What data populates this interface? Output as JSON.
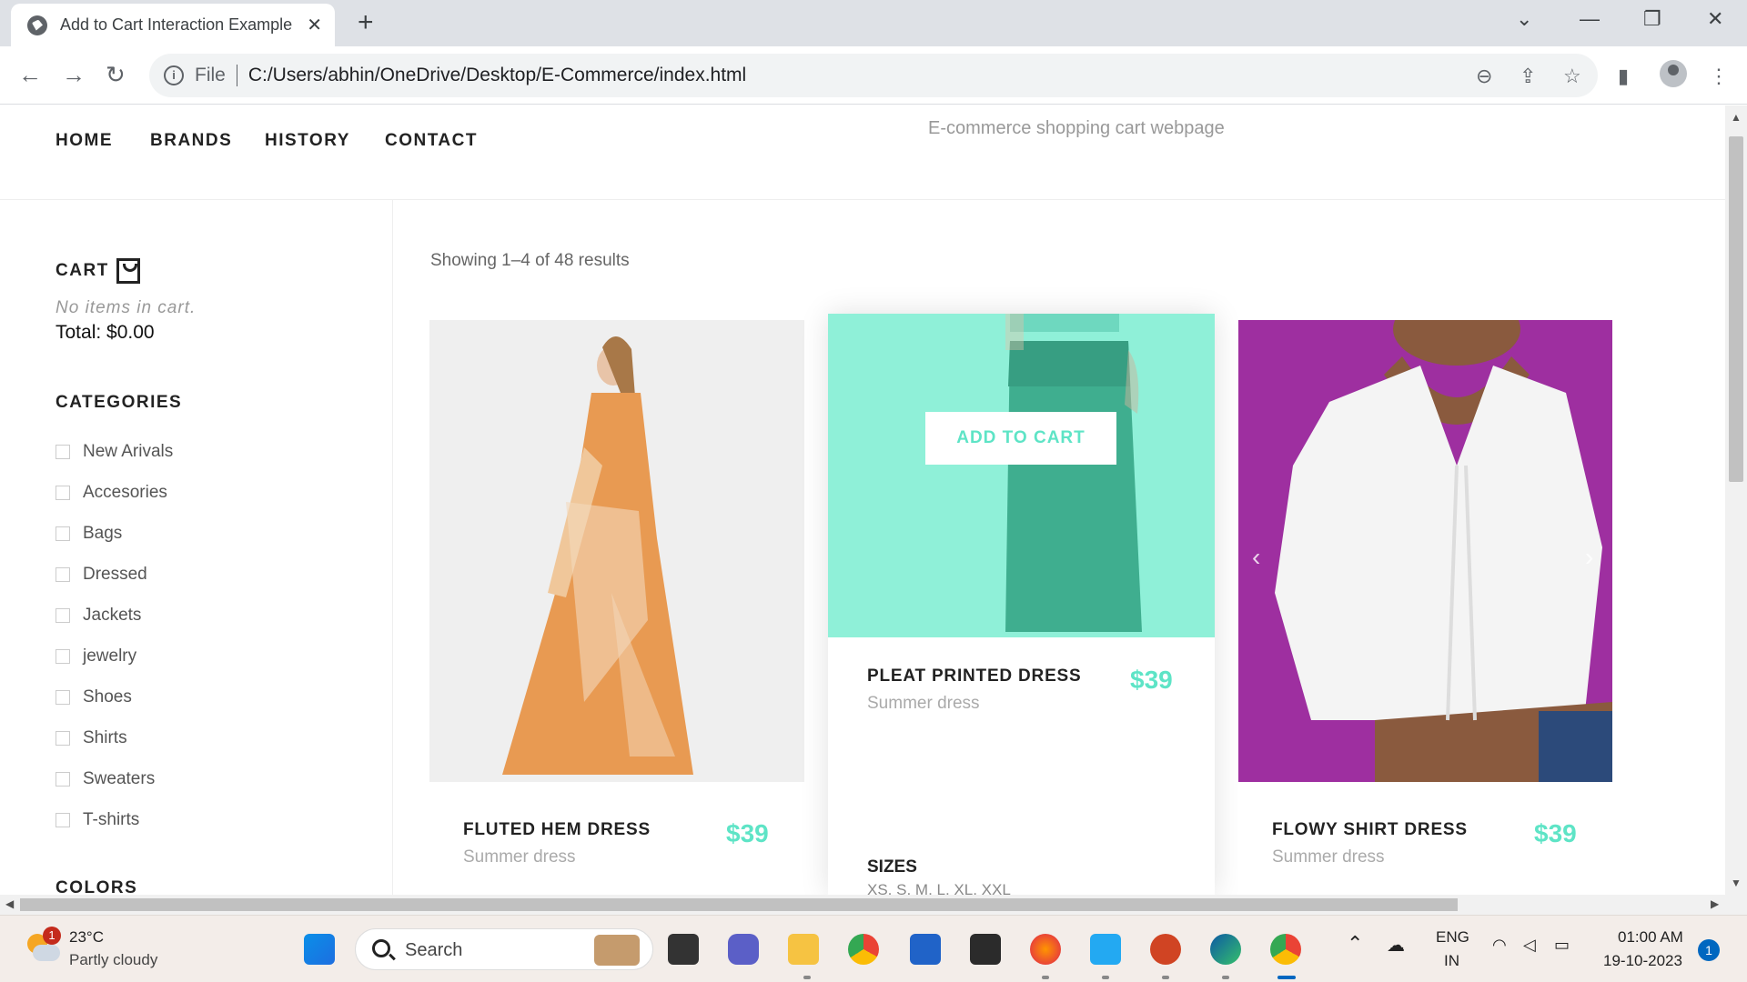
{
  "browser": {
    "tab_title": "Add to Cart Interaction Example",
    "url_scheme": "File",
    "url": "C:/Users/abhin/OneDrive/Desktop/E-Commerce/index.html"
  },
  "nav": {
    "links": [
      "HOME",
      "BRANDS",
      "HISTORY",
      "CONTACT"
    ],
    "tagline": "E-commerce shopping cart webpage"
  },
  "cart": {
    "heading": "CART",
    "empty_text": "No items in cart.",
    "total": "Total: $0.00"
  },
  "categories": {
    "heading": "CATEGORIES",
    "items": [
      "New Arivals",
      "Accesories",
      "Bags",
      "Dressed",
      "Jackets",
      "jewelry",
      "Shoes",
      "Shirts",
      "Sweaters",
      "T-shirts"
    ]
  },
  "colors": {
    "heading": "COLORS"
  },
  "results_text": "Showing 1–4 of 48 results",
  "products": [
    {
      "name": "FLUTED HEM DRESS",
      "subtitle": "Summer dress",
      "price": "$39"
    },
    {
      "name": "PLEAT PRINTED DRESS",
      "subtitle": "Summer dress",
      "price": "$39",
      "button": "ADD TO CART",
      "sizes_label": "SIZES",
      "sizes": "XS, S, M, L, XL, XXL"
    },
    {
      "name": "FLOWY SHIRT DRESS",
      "subtitle": "Summer dress",
      "price": "$39"
    }
  ],
  "accent_color": "#5ee4c6",
  "taskbar": {
    "weather_temp": "23°C",
    "weather_desc": "Partly cloudy",
    "weather_badge": "1",
    "search_label": "Search",
    "lang_top": "ENG",
    "lang_bottom": "IN",
    "time": "01:00 AM",
    "date": "19-10-2023",
    "notification_count": "1"
  }
}
